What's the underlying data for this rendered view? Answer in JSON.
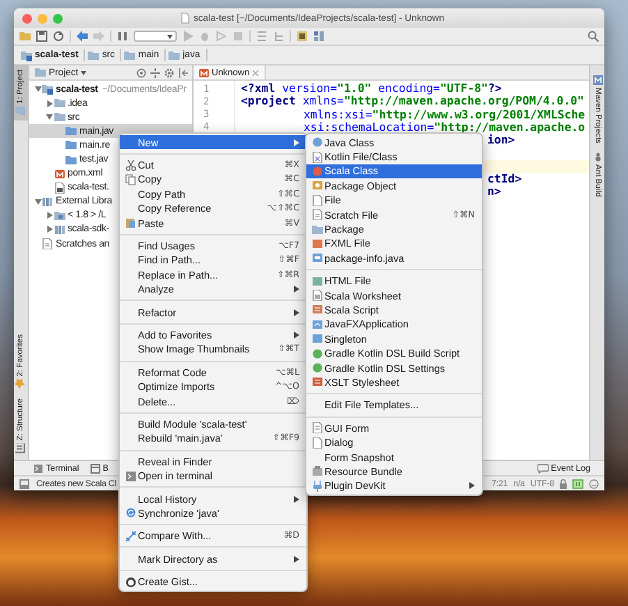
{
  "window": {
    "title": "scala-test [~/Documents/IdeaProjects/scala-test] - Unknown"
  },
  "breadcrumbs": [
    {
      "label": "scala-test",
      "kind": "module"
    },
    {
      "label": "src",
      "kind": "folder"
    },
    {
      "label": "main",
      "kind": "folder"
    },
    {
      "label": "java",
      "kind": "folder"
    }
  ],
  "left_tool_tabs": [
    {
      "label": "1: Project",
      "selected": true
    },
    {
      "label": "2: Favorites",
      "selected": false
    },
    {
      "label": "Z: Structure",
      "selected": false
    }
  ],
  "project_panel": {
    "title": "Project",
    "tree": [
      {
        "label": "scala-test",
        "hint": "~/Documents/IdeaPr",
        "kind": "module",
        "expanded": true,
        "selected": false,
        "children": [
          {
            "label": ".idea",
            "kind": "folder",
            "expanded": false,
            "selected": false
          },
          {
            "label": "src",
            "kind": "folder",
            "expanded": true,
            "selected": false,
            "children": [
              {
                "label": "main.jav",
                "kind": "source-root",
                "selected": true
              },
              {
                "label": "main.re",
                "kind": "source-root",
                "selected": false
              },
              {
                "label": "test.jav",
                "kind": "source-root",
                "selected": false
              }
            ]
          },
          {
            "label": "pom.xml",
            "kind": "maven-file",
            "selected": false
          },
          {
            "label": "scala-test.",
            "kind": "module-file",
            "selected": false
          }
        ]
      },
      {
        "label": "External Libra",
        "kind": "library",
        "expanded": true,
        "selected": false,
        "children": [
          {
            "label": "< 1.8 > /L",
            "kind": "sdk",
            "expanded": false,
            "selected": false
          },
          {
            "label": "scala-sdk-",
            "kind": "library",
            "expanded": false,
            "selected": false
          }
        ]
      },
      {
        "label": "Scratches an",
        "kind": "scratches",
        "selected": false
      }
    ]
  },
  "editor": {
    "tab": {
      "label": "Unknown"
    },
    "lines": [
      {
        "number": "1",
        "kind": "full",
        "tokens": [
          {
            "kind": "tag",
            "text": "<?xml"
          },
          {
            "kind": "attr",
            "text": " version="
          },
          {
            "kind": "value",
            "text": "\"1.0\""
          },
          {
            "kind": "attr",
            "text": " encoding="
          },
          {
            "kind": "value",
            "text": "\"UTF-8\""
          },
          {
            "kind": "tag",
            "text": "?>"
          }
        ]
      },
      {
        "number": "2",
        "kind": "full",
        "tokens": [
          {
            "kind": "tag",
            "text": "<project"
          },
          {
            "kind": "attr",
            "text": " xmlns="
          },
          {
            "kind": "value",
            "text": "\"http://maven.apache.org/POM/4.0.0\""
          }
        ]
      },
      {
        "number": "3",
        "kind": "indented",
        "tokens": [
          {
            "kind": "attr",
            "text": "xmlns:xsi="
          },
          {
            "kind": "value",
            "text": "\"http://www.w3.org/2001/XMLSche"
          }
        ]
      },
      {
        "number": "4",
        "kind": "indented",
        "tokens": [
          {
            "kind": "attr",
            "text": "xsi:schemaLocation="
          },
          {
            "kind": "value",
            "text": "\"http://maven.apache.o"
          }
        ]
      },
      {
        "kind": "partial",
        "tokens": [
          {
            "kind": "tag",
            "text": "ion>"
          }
        ]
      },
      {
        "kind": "blank"
      },
      {
        "kind": "caret-line"
      },
      {
        "kind": "partial",
        "tokens": [
          {
            "kind": "tag",
            "text": "ctId>"
          }
        ]
      },
      {
        "kind": "partial",
        "tokens": [
          {
            "kind": "tag",
            "text": "n>"
          }
        ]
      }
    ]
  },
  "right_tool_tabs": [
    {
      "label": "Maven Projects"
    },
    {
      "label": "Ant Build"
    }
  ],
  "bottom_tool_tabs": [
    {
      "label": "Terminal"
    },
    {
      "label": "B"
    }
  ],
  "event_log": {
    "label": "Event Log"
  },
  "status_bar": {
    "message": "Creates new Scala Cl",
    "position": "7:21",
    "line_separator": "n/a",
    "encoding": "UTF-8"
  },
  "context_menu": {
    "items": [
      {
        "kind": "item",
        "label": "New",
        "submenu": true,
        "selected": true
      },
      {
        "kind": "separator"
      },
      {
        "kind": "item",
        "label": "Cut",
        "shortcut": "⌘X",
        "selected": false
      },
      {
        "kind": "item",
        "label": "Copy",
        "shortcut": "⌘C",
        "selected": false
      },
      {
        "kind": "item",
        "label": "Copy Path",
        "shortcut": "⇧⌘C",
        "selected": false
      },
      {
        "kind": "item",
        "label": "Copy Reference",
        "shortcut": "⌥⇧⌘C",
        "selected": false
      },
      {
        "kind": "item",
        "label": "Paste",
        "shortcut": "⌘V",
        "selected": false
      },
      {
        "kind": "separator"
      },
      {
        "kind": "item",
        "label": "Find Usages",
        "shortcut": "⌥F7",
        "selected": false
      },
      {
        "kind": "item",
        "label": "Find in Path...",
        "shortcut": "⇧⌘F",
        "selected": false
      },
      {
        "kind": "item",
        "label": "Replace in Path...",
        "shortcut": "⇧⌘R",
        "selected": false
      },
      {
        "kind": "item",
        "label": "Analyze",
        "submenu": true,
        "selected": false
      },
      {
        "kind": "separator"
      },
      {
        "kind": "item",
        "label": "Refactor",
        "submenu": true,
        "selected": false
      },
      {
        "kind": "separator"
      },
      {
        "kind": "item",
        "label": "Add to Favorites",
        "submenu": true,
        "selected": false
      },
      {
        "kind": "item",
        "label": "Show Image Thumbnails",
        "shortcut": "⇧⌘T",
        "selected": false
      },
      {
        "kind": "separator"
      },
      {
        "kind": "item",
        "label": "Reformat Code",
        "shortcut": "⌥⌘L",
        "selected": false
      },
      {
        "kind": "item",
        "label": "Optimize Imports",
        "shortcut": "^⌥O",
        "selected": false
      },
      {
        "kind": "item",
        "label": "Delete...",
        "shortcut": "⌦",
        "selected": false
      },
      {
        "kind": "separator"
      },
      {
        "kind": "item",
        "label": "Build Module 'scala-test'",
        "selected": false
      },
      {
        "kind": "item",
        "label": "Rebuild 'main.java'",
        "shortcut": "⇧⌘F9",
        "selected": false
      },
      {
        "kind": "separator"
      },
      {
        "kind": "item",
        "label": "Reveal in Finder",
        "selected": false
      },
      {
        "kind": "item",
        "label": "Open in terminal",
        "selected": false
      },
      {
        "kind": "separator"
      },
      {
        "kind": "item",
        "label": "Local History",
        "submenu": true,
        "selected": false
      },
      {
        "kind": "item",
        "label": "Synchronize 'java'",
        "selected": false
      },
      {
        "kind": "separator"
      },
      {
        "kind": "item",
        "label": "Compare With...",
        "shortcut": "⌘D",
        "selected": false
      },
      {
        "kind": "separator"
      },
      {
        "kind": "item",
        "label": "Mark Directory as",
        "submenu": true,
        "selected": false
      },
      {
        "kind": "separator"
      },
      {
        "kind": "item",
        "label": "Create Gist...",
        "selected": false
      }
    ]
  },
  "new_submenu": {
    "items": [
      {
        "kind": "item",
        "label": "Java Class",
        "selected": false
      },
      {
        "kind": "item",
        "label": "Kotlin File/Class",
        "selected": false
      },
      {
        "kind": "item",
        "label": "Scala Class",
        "selected": true
      },
      {
        "kind": "item",
        "label": "Package Object",
        "selected": false
      },
      {
        "kind": "item",
        "label": "File",
        "selected": false
      },
      {
        "kind": "item",
        "label": "Scratch File",
        "shortcut": "⇧⌘N",
        "selected": false
      },
      {
        "kind": "item",
        "label": "Package",
        "selected": false
      },
      {
        "kind": "item",
        "label": "FXML File",
        "selected": false
      },
      {
        "kind": "item",
        "label": "package-info.java",
        "selected": false
      },
      {
        "kind": "separator"
      },
      {
        "kind": "item",
        "label": "HTML File",
        "selected": false
      },
      {
        "kind": "item",
        "label": "Scala Worksheet",
        "selected": false
      },
      {
        "kind": "item",
        "label": "Scala Script",
        "selected": false
      },
      {
        "kind": "item",
        "label": "JavaFXApplication",
        "selected": false
      },
      {
        "kind": "item",
        "label": "Singleton",
        "selected": false
      },
      {
        "kind": "item",
        "label": "Gradle Kotlin DSL Build Script",
        "selected": false
      },
      {
        "kind": "item",
        "label": "Gradle Kotlin DSL Settings",
        "selected": false
      },
      {
        "kind": "item",
        "label": "XSLT Stylesheet",
        "selected": false
      },
      {
        "kind": "separator"
      },
      {
        "kind": "item",
        "label": "Edit File Templates...",
        "selected": false
      },
      {
        "kind": "separator"
      },
      {
        "kind": "item",
        "label": "GUI Form",
        "selected": false
      },
      {
        "kind": "item",
        "label": "Dialog",
        "selected": false
      },
      {
        "kind": "item",
        "label": "Form Snapshot",
        "selected": false
      },
      {
        "kind": "item",
        "label": "Resource Bundle",
        "selected": false
      },
      {
        "kind": "item",
        "label": "Plugin DevKit",
        "submenu": true,
        "selected": false
      }
    ]
  }
}
